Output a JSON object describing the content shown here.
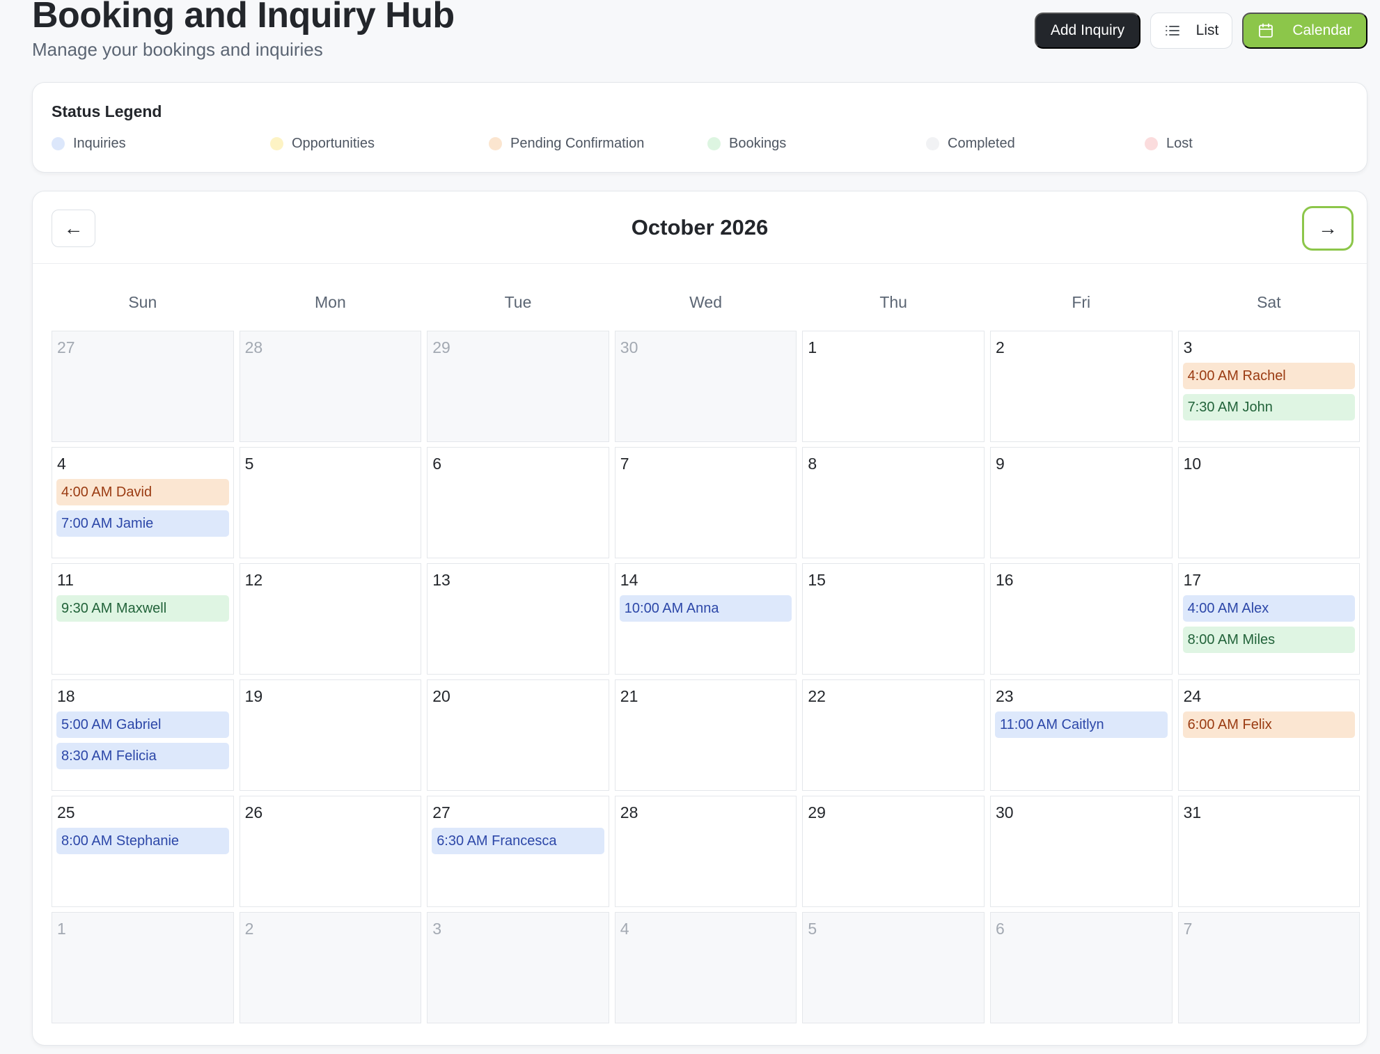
{
  "header": {
    "title": "Booking and Inquiry Hub",
    "subtitle": "Manage your bookings and inquiries"
  },
  "toolbar": {
    "add_label": "Add Inquiry",
    "list_label": "List",
    "list_icon": "list-icon",
    "calendar_label": "Calendar",
    "calendar_icon": "calendar-icon",
    "active_view": "Calendar"
  },
  "colors": {
    "accent": "#8cc64a",
    "dark": "#23262b"
  },
  "legend": {
    "title": "Status Legend",
    "items": [
      {
        "label": "Inquiries",
        "color": "#dce7fb"
      },
      {
        "label": "Opportunities",
        "color": "#fdf3c4"
      },
      {
        "label": "Pending Confirmation",
        "color": "#fbe5cf"
      },
      {
        "label": "Bookings",
        "color": "#ddf5e1"
      },
      {
        "label": "Completed",
        "color": "#f1f2f4"
      },
      {
        "label": "Lost",
        "color": "#fbdcdd"
      }
    ]
  },
  "event_styles": {
    "Inquiries": {
      "bg": "#dde8fb",
      "fg": "#2c47a8"
    },
    "Pending Confirmation": {
      "bg": "#fbe6d2",
      "fg": "#9a3b12"
    },
    "Bookings": {
      "bg": "#dff5e3",
      "fg": "#22633a"
    }
  },
  "calendar": {
    "month_title": "October 2026",
    "prev_label": "←",
    "next_label": "→",
    "weekdays": [
      "Sun",
      "Mon",
      "Tue",
      "Wed",
      "Thu",
      "Fri",
      "Sat"
    ],
    "days": [
      {
        "day": "27",
        "muted": true,
        "events": []
      },
      {
        "day": "28",
        "muted": true,
        "events": []
      },
      {
        "day": "29",
        "muted": true,
        "events": []
      },
      {
        "day": "30",
        "muted": true,
        "events": []
      },
      {
        "day": "1",
        "events": []
      },
      {
        "day": "2",
        "events": []
      },
      {
        "day": "3",
        "events": [
          {
            "label": "4:00 AM Rachel",
            "status": "Pending Confirmation"
          },
          {
            "label": "7:30 AM John",
            "status": "Bookings"
          }
        ]
      },
      {
        "day": "4",
        "events": [
          {
            "label": "4:00 AM David",
            "status": "Pending Confirmation"
          },
          {
            "label": "7:00 AM Jamie",
            "status": "Inquiries"
          }
        ]
      },
      {
        "day": "5",
        "events": []
      },
      {
        "day": "6",
        "events": []
      },
      {
        "day": "7",
        "events": []
      },
      {
        "day": "8",
        "events": []
      },
      {
        "day": "9",
        "events": []
      },
      {
        "day": "10",
        "events": []
      },
      {
        "day": "11",
        "events": [
          {
            "label": "9:30 AM Maxwell",
            "status": "Bookings"
          }
        ]
      },
      {
        "day": "12",
        "events": []
      },
      {
        "day": "13",
        "events": []
      },
      {
        "day": "14",
        "events": [
          {
            "label": "10:00 AM Anna",
            "status": "Inquiries"
          }
        ]
      },
      {
        "day": "15",
        "events": []
      },
      {
        "day": "16",
        "events": []
      },
      {
        "day": "17",
        "events": [
          {
            "label": "4:00 AM Alex",
            "status": "Inquiries"
          },
          {
            "label": "8:00 AM Miles",
            "status": "Bookings"
          }
        ]
      },
      {
        "day": "18",
        "events": [
          {
            "label": "5:00 AM Gabriel",
            "status": "Inquiries"
          },
          {
            "label": "8:30 AM Felicia",
            "status": "Inquiries"
          }
        ]
      },
      {
        "day": "19",
        "events": []
      },
      {
        "day": "20",
        "events": []
      },
      {
        "day": "21",
        "events": []
      },
      {
        "day": "22",
        "events": []
      },
      {
        "day": "23",
        "events": [
          {
            "label": "11:00 AM Caitlyn",
            "status": "Inquiries"
          }
        ]
      },
      {
        "day": "24",
        "events": [
          {
            "label": "6:00 AM Felix",
            "status": "Pending Confirmation"
          }
        ]
      },
      {
        "day": "25",
        "events": [
          {
            "label": "8:00 AM Stephanie",
            "status": "Inquiries"
          }
        ]
      },
      {
        "day": "26",
        "events": []
      },
      {
        "day": "27",
        "events": [
          {
            "label": "6:30 AM Francesca",
            "status": "Inquiries"
          }
        ]
      },
      {
        "day": "28",
        "events": []
      },
      {
        "day": "29",
        "events": []
      },
      {
        "day": "30",
        "events": []
      },
      {
        "day": "31",
        "events": []
      },
      {
        "day": "1",
        "muted": true,
        "events": []
      },
      {
        "day": "2",
        "muted": true,
        "events": []
      },
      {
        "day": "3",
        "muted": true,
        "events": []
      },
      {
        "day": "4",
        "muted": true,
        "events": []
      },
      {
        "day": "5",
        "muted": true,
        "events": []
      },
      {
        "day": "6",
        "muted": true,
        "events": []
      },
      {
        "day": "7",
        "muted": true,
        "events": []
      }
    ]
  }
}
